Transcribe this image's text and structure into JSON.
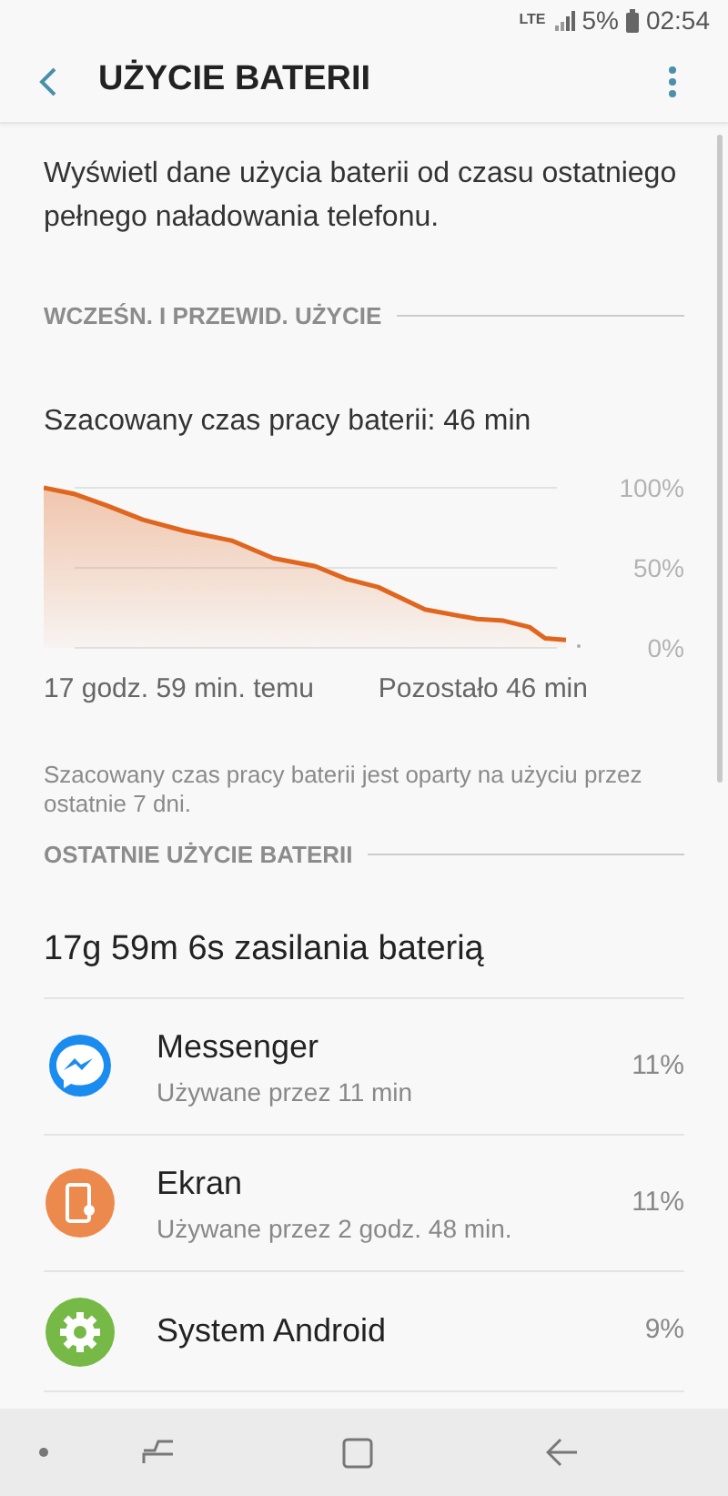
{
  "status_bar": {
    "network": "LTE",
    "battery": "5%",
    "time": "02:54"
  },
  "header": {
    "title": "UŻYCIE BATERII"
  },
  "description": "Wyświetl dane użycia baterii od czasu ostatniego pełnego naładowania telefonu.",
  "sections": [
    {
      "title": "WCZEŚN. I PRZEWID. UŻYCIE"
    },
    {
      "title": "OSTATNIE UŻYCIE BATERII"
    }
  ],
  "estimate": "Szacowany czas pracy baterii: 46 min",
  "chart": {
    "axis_labels": [
      "100%",
      "50%",
      "0%"
    ],
    "time_labels": [
      "17 godz. 59 min. temu",
      "Pozostało 46 min"
    ]
  },
  "note": "Szacowany czas pracy baterii jest oparty na użyciu przez ostatnie 7 dni.",
  "total": "17g 59m 6s zasilania baterią",
  "apps": [
    {
      "name": "Messenger",
      "detail": "Używane przez 11 min",
      "percent": "11%",
      "kind": "messenger",
      "color": "#1a8cf0"
    },
    {
      "name": "Ekran",
      "detail": "Używane przez 2 godz. 48 min.",
      "percent": "11%",
      "kind": "screen",
      "color": "#ec8a4e"
    },
    {
      "name": "System Android",
      "percent": "9%",
      "kind": "system",
      "color": "#76b947"
    }
  ]
}
